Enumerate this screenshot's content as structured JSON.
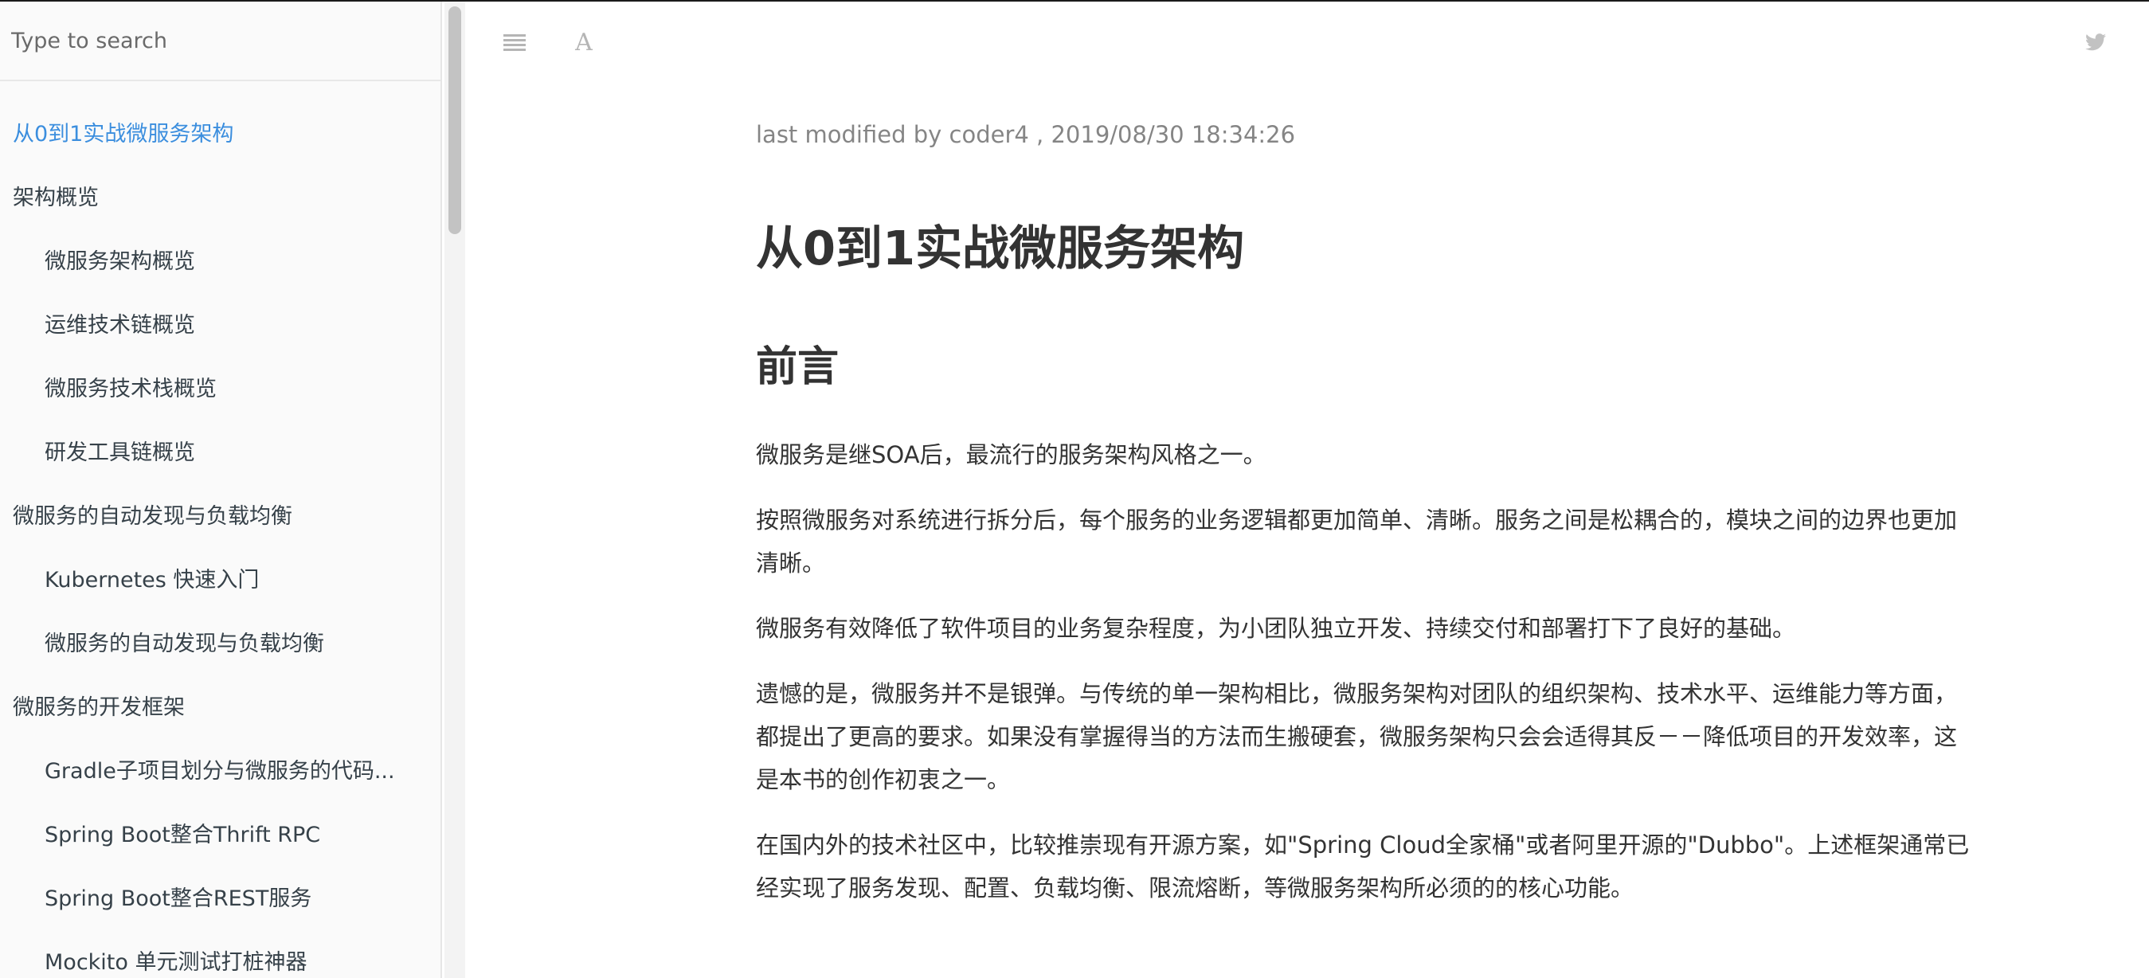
{
  "search": {
    "placeholder": "Type to search"
  },
  "toc": [
    {
      "label": "从0到1实战微服务架构",
      "level": 0,
      "active": true
    },
    {
      "label": "架构概览",
      "level": 0
    },
    {
      "label": "微服务架构概览",
      "level": 1
    },
    {
      "label": "运维技术链概览",
      "level": 1
    },
    {
      "label": "微服务技术栈概览",
      "level": 1
    },
    {
      "label": "研发工具链概览",
      "level": 1
    },
    {
      "label": "微服务的自动发现与负载均衡",
      "level": 0
    },
    {
      "label": "Kubernetes 快速入门",
      "level": 1
    },
    {
      "label": "微服务的自动发现与负载均衡",
      "level": 1
    },
    {
      "label": "微服务的开发框架",
      "level": 0
    },
    {
      "label": "Gradle子项目划分与微服务的代码...",
      "level": 1
    },
    {
      "label": "Spring Boot整合Thrift RPC",
      "level": 1
    },
    {
      "label": "Spring Boot整合REST服务",
      "level": 1
    },
    {
      "label": "Mockito 单元测试打桩神器",
      "level": 1
    }
  ],
  "toolbar": {
    "menu_icon": "menu-icon",
    "font_icon": "font-settings-icon",
    "font_glyph": "A",
    "share_icon": "twitter-icon"
  },
  "article": {
    "meta": "last modified by coder4 , 2019/08/30 18:34:26",
    "title": "从0到1实战微服务架构",
    "section": "前言",
    "paragraphs": [
      "微服务是继SOA后，最流行的服务架构风格之一。",
      "按照微服务对系统进行拆分后，每个服务的业务逻辑都更加简单、清晰。服务之间是松耦合的，模块之间的边界也更加清晰。",
      "微服务有效降低了软件项目的业务复杂程度，为小团队独立开发、持续交付和部署打下了良好的基础。",
      "遗憾的是，微服务并不是银弹。与传统的单一架构相比，微服务架构对团队的组织架构、技术水平、运维能力等方面，都提出了更高的要求。如果没有掌握得当的方法而生搬硬套，微服务架构只会会适得其反－－降低项目的开发效率，这是本书的创作初衷之一。",
      "在国内外的技术社区中，比较推崇现有开源方案，如\"Spring Cloud全家桶\"或者阿里开源的\"Dubbo\"。上述框架通常已经实现了服务发现、配置、负载均衡、限流熔断，等微服务架构所必须的的核心功能。"
    ]
  },
  "colors": {
    "active_link": "#3b8ede",
    "text": "#333333",
    "muted": "#858585",
    "sidebar_bg": "#fafafa"
  }
}
